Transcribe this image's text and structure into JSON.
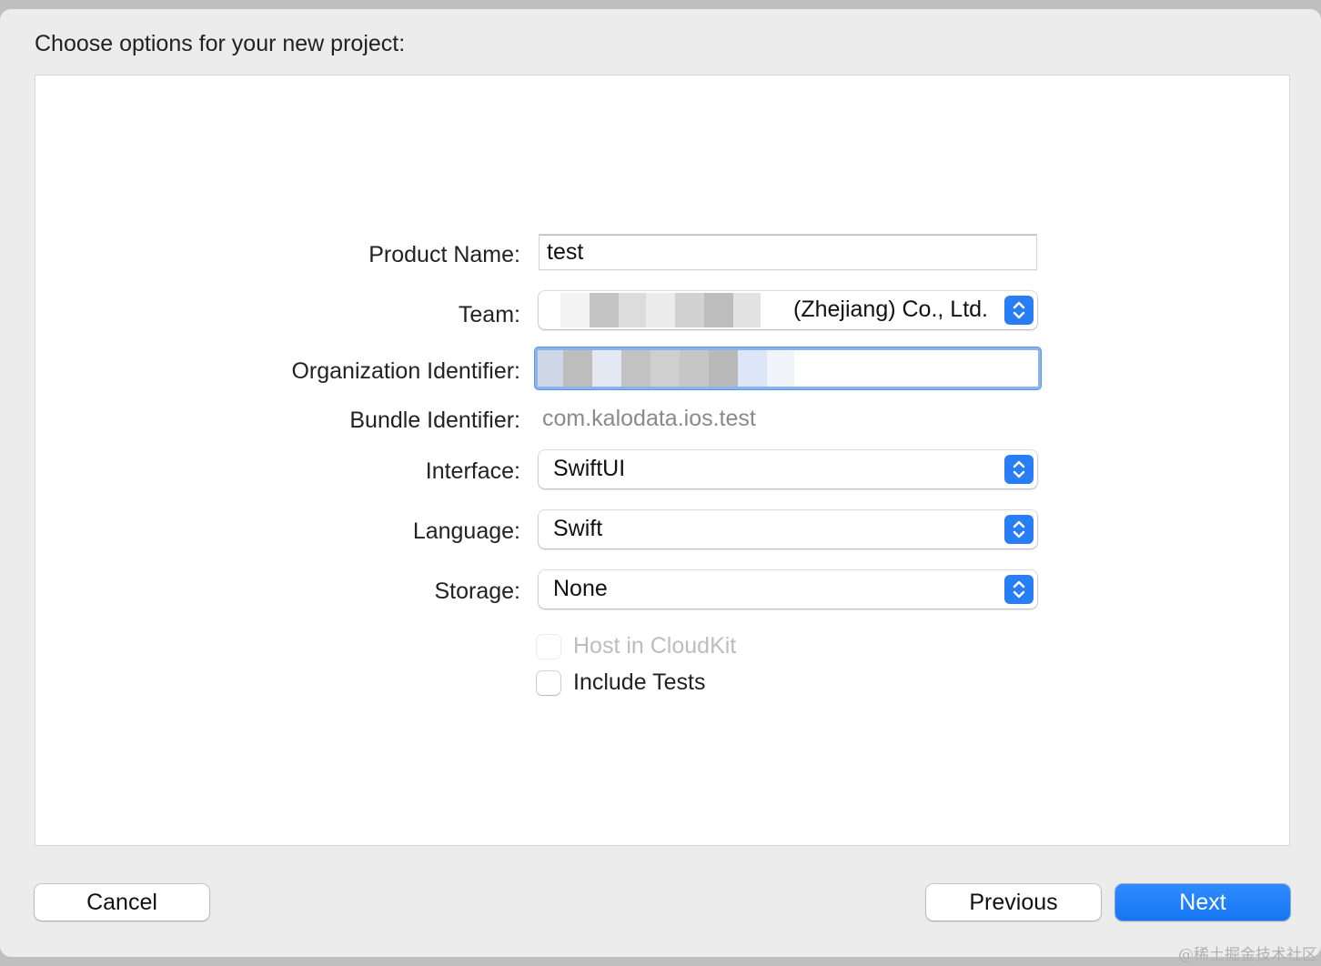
{
  "dialog": {
    "title": "Choose options for your new project:"
  },
  "form": {
    "product_name": {
      "label": "Product Name:",
      "value": "test"
    },
    "team": {
      "label": "Team:",
      "value": "(Zhejiang) Co., Ltd."
    },
    "organization_identifier": {
      "label": "Organization Identifier:",
      "value": ""
    },
    "bundle_identifier": {
      "label": "Bundle Identifier:",
      "value": "com.kalodata.ios.test"
    },
    "interface": {
      "label": "Interface:",
      "value": "SwiftUI"
    },
    "language": {
      "label": "Language:",
      "value": "Swift"
    },
    "storage": {
      "label": "Storage:",
      "value": "None"
    },
    "host_in_cloudkit": {
      "label": "Host in CloudKit",
      "checked": false,
      "enabled": false
    },
    "include_tests": {
      "label": "Include Tests",
      "checked": false,
      "enabled": true
    }
  },
  "buttons": {
    "cancel": "Cancel",
    "previous": "Previous",
    "next": "Next"
  },
  "watermark": "@稀土掘金技术社区",
  "colors": {
    "accent": "#1676f3",
    "focus_ring": "#8ab4f0"
  }
}
